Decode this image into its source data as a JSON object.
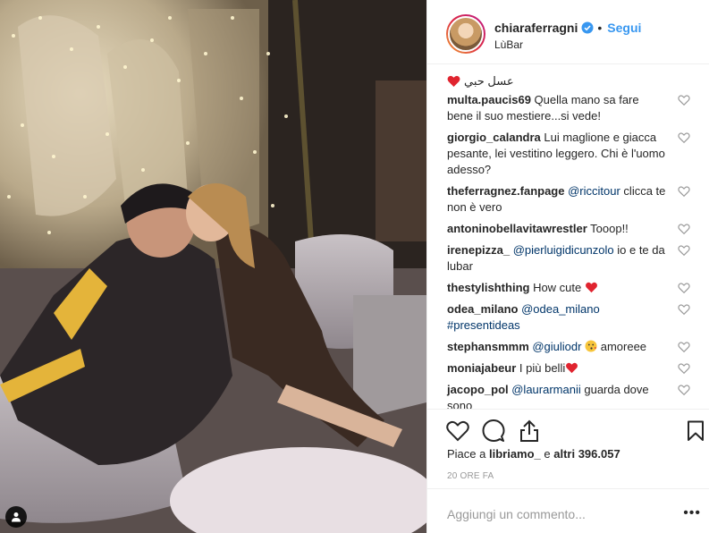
{
  "post": {
    "username": "chiaraferragni",
    "follow_label": "Segui",
    "separator": "•",
    "location": "LùBar",
    "caption_text": "عسل حبي"
  },
  "comments": [
    {
      "user": "multa.paucis69",
      "text": " Quella mano sa fare bene il suo mestiere...si vede!"
    },
    {
      "user": "giorgio_calandra",
      "text": " Lui maglione e giacca pesante, lei vestitino leggero. Chi è l'uomo adesso?"
    },
    {
      "user": "theferragnez.fanpage",
      "mention": " @riccitour",
      "text": " clicca te non è vero"
    },
    {
      "user": "antoninobellavitawrestler",
      "text": " Tooop!!"
    },
    {
      "user": "irenepizza_",
      "mention": " @pierluigidicunzolo",
      "text": " io e te da lubar"
    },
    {
      "user": "thestylishthing",
      "text": " How cute "
    },
    {
      "user": "odea_milano",
      "mention": " @odea_milano",
      "text2": " #presentideas"
    },
    {
      "user": "stephansmmm",
      "mention": " @giuliodr",
      "text": " amoreee"
    },
    {
      "user": "moniajabeur",
      "text": " I più belli"
    },
    {
      "user": "jacopo_pol",
      "mention": " @laurarmanii",
      "text": " guarda dove sono"
    }
  ],
  "likes": {
    "prefix": "Piace a ",
    "user": "libriamo_",
    "middle": " e ",
    "count": "altri 396.057"
  },
  "timestamp": "20 ORE FA",
  "add_comment_placeholder": "Aggiungi un commento...",
  "more_label": "•••",
  "colors": {
    "accent": "#3897f0",
    "heart": "#ed4956",
    "mention": "#003569"
  }
}
